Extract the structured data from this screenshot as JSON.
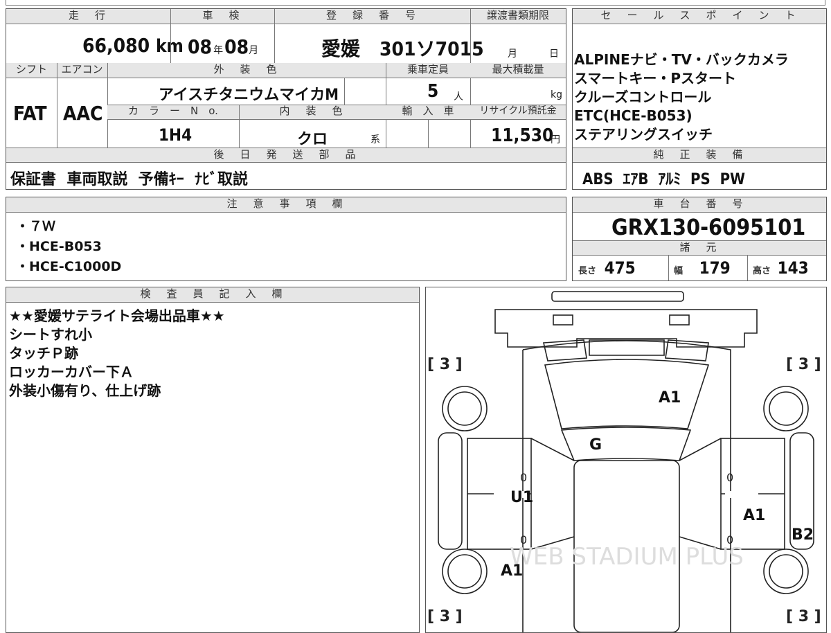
{
  "top": {
    "headers": {
      "mileage": "走　行",
      "inspection": "車　検",
      "registration": "登　録　番　号",
      "transfer_deadline": "譲渡書類期限"
    },
    "mileage": "66,080",
    "mileage_unit": "km",
    "inspection_year": "08",
    "year_unit": "年",
    "inspection_month": "08",
    "month_unit": "月",
    "registration_number": "愛媛　301ソ7015",
    "deadline_month_unit": "月",
    "deadline_day_unit": "日"
  },
  "middle": {
    "headers": {
      "shift": "シフト",
      "aircon": "エアコン",
      "exterior_color": "外　装　色",
      "capacity": "乗車定員",
      "max_load": "最大積載量",
      "color_no": "カ　ラ　ー　N　o.",
      "interior_color": "内　装　色",
      "import": "輸　入　車",
      "recycle": "リサイクル預託金"
    },
    "shift": "FAT",
    "aircon": "AAC",
    "exterior_color": "アイスチタニウムマイカM",
    "capacity": "5",
    "capacity_unit": "人",
    "max_load_unit": "kg",
    "color_no": "1H4",
    "interior_color": "クロ",
    "interior_suffix": "系",
    "recycle_fee": "11,530",
    "recycle_unit": "円"
  },
  "later_parts": {
    "header": "後　日　発　送　部　品",
    "value": "保証書  車両取説  予備ｷｰ  ﾅﾋﾞ取説"
  },
  "sales_points": {
    "header": "セ　ー　ル　ス　ポ　イ　ン　ト",
    "lines": [
      "ALPINEナビ・TV・バックカメラ",
      "スマートキー・Pスタート",
      "クルーズコントロール",
      "ETC(HCE-B053)",
      "ステアリングスイッチ"
    ]
  },
  "equipment": {
    "header": "純　正　装　備",
    "value": "ABS  ｴｱB  ｱﾙﾐ  PS  PW"
  },
  "notes": {
    "header": "注　意　事　項　欄",
    "items": [
      "・７Ｗ",
      "・HCE-B053",
      "・HCE-C1000D"
    ]
  },
  "chassis": {
    "header": "車　台　番　号",
    "value": "GRX130-6095101"
  },
  "specs": {
    "header": "諸　元",
    "length_label": "長さ",
    "length": "475",
    "width_label": "幅",
    "width": "179",
    "height_label": "高さ",
    "height": "143"
  },
  "inspector": {
    "header": "検　査　員　記　入　欄",
    "lines": [
      "★★愛媛サテライト会場出品車★★",
      "シートすれ小",
      "タッチＰ跡",
      "ロッカーカバー下Ａ",
      "外装小傷有り、仕上げ跡"
    ]
  },
  "diagram": {
    "tire_tl": "[ 3 ]",
    "tire_tr": "[ 3 ]",
    "tire_bl": "[ 3 ]",
    "tire_br": "[ 3 ]",
    "marks": {
      "hood": "A1",
      "windshield": "G",
      "left_door": "U1",
      "left_rear": "A1",
      "right_door": "A1",
      "right_rear": "B2",
      "zero_1": "0",
      "zero_2": "0",
      "zero_3": "0",
      "zero_4": "0"
    },
    "watermark": "WEB STADIUM PLUS"
  }
}
